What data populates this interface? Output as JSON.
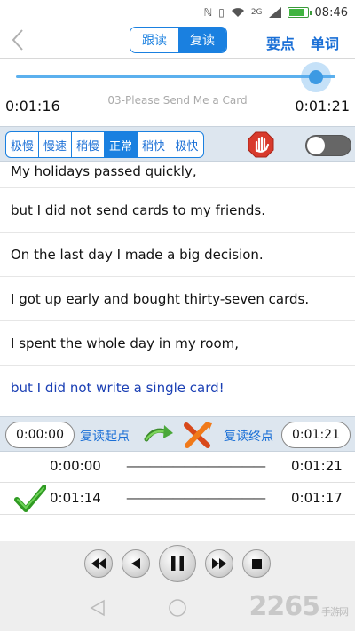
{
  "status": {
    "network": "2G",
    "time": "08:46",
    "battery_level": 0.85
  },
  "nav": {
    "back_icon": "chevron-left-icon",
    "mode_follow": "跟读",
    "mode_repeat": "复读",
    "key_points": "要点",
    "vocabulary": "单词"
  },
  "progress": {
    "current_time": "0:01:16",
    "end_time": "0:01:21",
    "track_name": "03-Please Send Me a Card",
    "fraction": 0.94
  },
  "speed": {
    "options": [
      "极慢",
      "慢速",
      "稍慢",
      "正常",
      "稍快",
      "极快"
    ],
    "selected": "正常"
  },
  "sentences": [
    "My holidays passed quickly,",
    "but I did not send cards to my friends.",
    "On the last day I made a big decision.",
    "I got up early and bought thirty-seven cards.",
    "I spent the whole day in my room,",
    "but I did not write a single card!"
  ],
  "repeat": {
    "start_time": "0:00:00",
    "start_label": "复读起点",
    "end_label": "复读终点",
    "end_time": "0:01:21"
  },
  "loops": [
    {
      "start": "0:00:00",
      "dashes": "————————————",
      "end": "0:01:21",
      "checked": false
    },
    {
      "start": "0:01:14",
      "dashes": "————————————",
      "end": "0:01:17",
      "checked": true
    }
  ],
  "watermark": {
    "brand": "2265",
    "sub": "手游网"
  },
  "colors": {
    "accent": "#1a80e0",
    "current_sentence": "#1a3fb4"
  }
}
